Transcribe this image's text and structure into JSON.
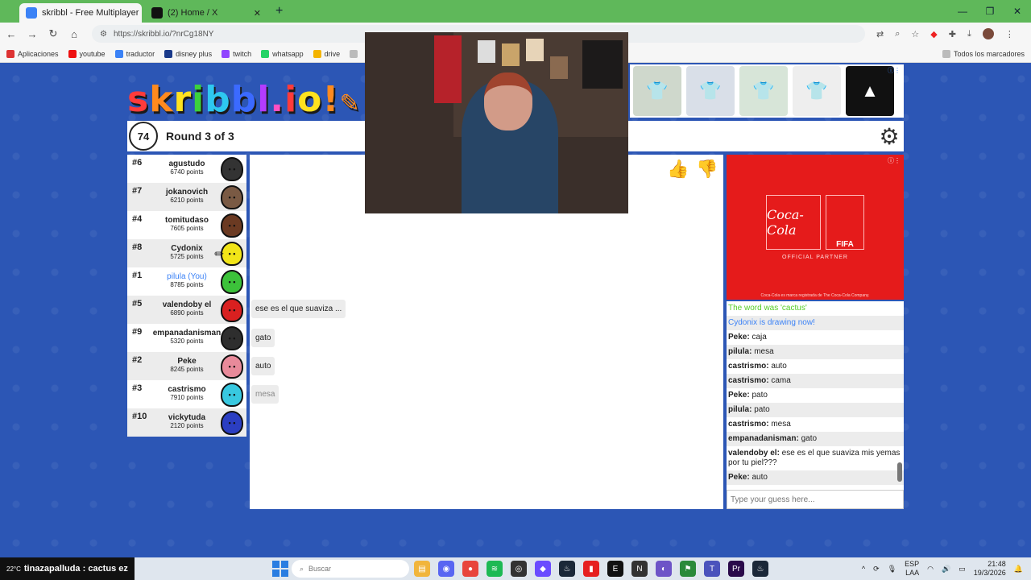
{
  "browser": {
    "tabs": [
      {
        "label": "skribbl - Free Multiplayer Drawi",
        "active": true
      },
      {
        "label": "(2) Home / X",
        "active": false
      }
    ],
    "url": "https://skribbl.io/?nrCg18NY",
    "bookmarks": [
      "Aplicaciones",
      "youtube",
      "traductor",
      "disney plus",
      "twitch",
      "whatsapp",
      "drive"
    ],
    "bookmarks_right": "Todos los marcadores"
  },
  "game": {
    "logo": "skribbl.io",
    "timer": "74",
    "round": "Round 3 of 3",
    "players": [
      {
        "rank": "#6",
        "name": "agustudo",
        "score": "6740 points",
        "color": "#333333"
      },
      {
        "rank": "#7",
        "name": "jokanovich",
        "score": "6210 points",
        "color": "#7a5a44"
      },
      {
        "rank": "#4",
        "name": "tomitudaso",
        "score": "7605 points",
        "color": "#6b3a22"
      },
      {
        "rank": "#8",
        "name": "Cydonix",
        "score": "5725 points",
        "color": "#f2e518"
      },
      {
        "rank": "#1",
        "name": "pilula (You)",
        "score": "8785 points",
        "color": "#3cc23a"
      },
      {
        "rank": "#5",
        "name": "valendoby el",
        "score": "6890 points",
        "color": "#d92020"
      },
      {
        "rank": "#9",
        "name": "empanadanisman",
        "score": "5320 points",
        "color": "#2e2e2e"
      },
      {
        "rank": "#2",
        "name": "Peke",
        "score": "8245 points",
        "color": "#e88a9a"
      },
      {
        "rank": "#3",
        "name": "castrismo",
        "score": "7910 points",
        "color": "#38c8e0"
      },
      {
        "rank": "#10",
        "name": "vickytuda",
        "score": "2120 points",
        "color": "#2b3ec2"
      }
    ],
    "bubbles": [
      "ese es el que suaviza ...",
      "gato",
      "auto",
      "mesa"
    ],
    "chat": [
      {
        "text": "The word was 'cactus'",
        "style": "green"
      },
      {
        "text": "Cydonix is drawing now!",
        "style": "blue"
      },
      {
        "user": "Peke:",
        "text": " caja"
      },
      {
        "user": "pilula:",
        "text": " mesa"
      },
      {
        "user": "castrismo:",
        "text": " auto"
      },
      {
        "user": "castrismo:",
        "text": " cama"
      },
      {
        "user": "Peke:",
        "text": " pato"
      },
      {
        "user": "pilula:",
        "text": " pato"
      },
      {
        "user": "castrismo:",
        "text": " mesa"
      },
      {
        "user": "empanadanisman:",
        "text": " gato"
      },
      {
        "user": "valendoby el:",
        "text": " ese es el que suaviza mis yemas por tu piel???"
      },
      {
        "user": "Peke:",
        "text": " auto"
      }
    ],
    "guess_placeholder": "Type your guess here...",
    "ad": {
      "brand": "Coca-Cola",
      "partner": "FIFA",
      "tagline": "OFFICIAL PARTNER",
      "fine_print": "Coca-Cola es marca registrada de The Coca-Cola Company."
    }
  },
  "taskbar": {
    "weather": "22°C",
    "stream_text": "tinazapalluda : cactus ez",
    "search_placeholder": "Buscar",
    "lang": "ESP",
    "region": "LAA",
    "time": "21:48",
    "date": "19/3/2026"
  }
}
